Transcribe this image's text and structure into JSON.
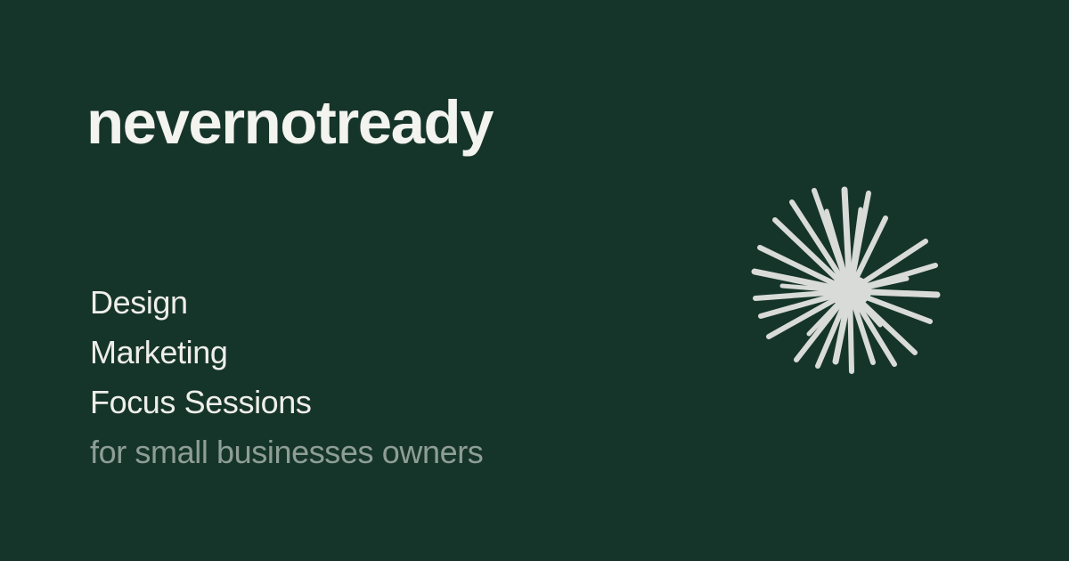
{
  "brand": {
    "name": "nevernotready"
  },
  "services": [
    "Design",
    "Marketing",
    "Focus Sessions"
  ],
  "tagline": "for small businesses owners",
  "logo": {
    "icon": "starburst-icon",
    "color": "#d9dbd8"
  },
  "colors": {
    "background": "#16352a",
    "text": "#eeeeea",
    "muted_text": "#8e9e97"
  }
}
